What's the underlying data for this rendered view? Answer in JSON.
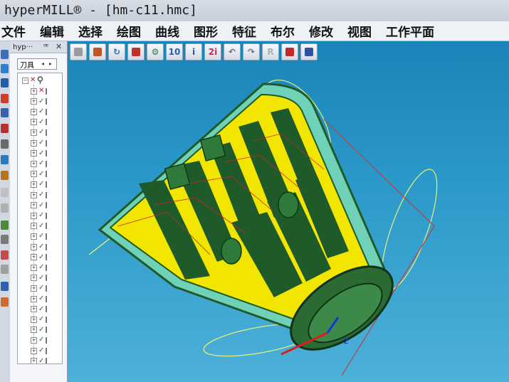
{
  "window": {
    "title": "hyperMILL® - [hm-c11.hmc]"
  },
  "menu": {
    "items": [
      "文件",
      "编辑",
      "选择",
      "绘图",
      "曲线",
      "图形",
      "特征",
      "布尔",
      "修改",
      "视图",
      "工作平面"
    ]
  },
  "browser_panel": {
    "title": "hyp···",
    "pin_label": "ꟹ",
    "close_label": "✕",
    "tab_label": "刀具",
    "root_expander": "−",
    "row_expander": "+",
    "rows": [
      {
        "status": "x"
      },
      {
        "status": "check"
      },
      {
        "status": "check"
      },
      {
        "status": "check"
      },
      {
        "status": "check"
      },
      {
        "status": "check"
      },
      {
        "status": "check"
      },
      {
        "status": "check"
      },
      {
        "status": "check"
      },
      {
        "status": "check"
      },
      {
        "status": "check"
      },
      {
        "status": "check"
      },
      {
        "status": "check"
      },
      {
        "status": "check"
      },
      {
        "status": "check"
      },
      {
        "status": "check"
      },
      {
        "status": "check"
      },
      {
        "status": "check"
      },
      {
        "status": "check"
      },
      {
        "status": "check"
      },
      {
        "status": "check"
      },
      {
        "status": "check"
      },
      {
        "status": "check"
      },
      {
        "status": "check"
      },
      {
        "status": "check"
      },
      {
        "status": "check"
      },
      {
        "status": "check"
      }
    ]
  },
  "toolbar": {
    "buttons": [
      {
        "icon": "new-document-icon",
        "glyph": ""
      },
      {
        "icon": "open-folder-icon",
        "glyph": ""
      },
      {
        "icon": "rotate-view-icon",
        "glyph": "↻"
      },
      {
        "icon": "box-solid-icon",
        "glyph": ""
      },
      {
        "icon": "gear-icon",
        "glyph": "⚙"
      },
      {
        "icon": "tool-10-icon",
        "glyph": "10"
      },
      {
        "icon": "info-icon",
        "glyph": "i"
      },
      {
        "icon": "info-2-icon",
        "glyph": "2i"
      },
      {
        "icon": "undo-icon",
        "glyph": "↶"
      },
      {
        "icon": "redo-icon",
        "glyph": "↷"
      },
      {
        "icon": "r-mode-icon",
        "glyph": "R"
      },
      {
        "icon": "cube-shaded-icon",
        "glyph": ""
      },
      {
        "icon": "magnet-icon",
        "glyph": ""
      }
    ]
  },
  "viewport": {
    "axis_label": "z"
  },
  "colors": {
    "part_yellow": "#f2e600",
    "part_green": "#1f5a2a",
    "part_teal": "#6fd2b8",
    "toolpath_red": "#d3202a",
    "toolpath_yellow": "#e8f07a",
    "axis_blue": "#1a33d8",
    "axis_red": "#d82020"
  }
}
